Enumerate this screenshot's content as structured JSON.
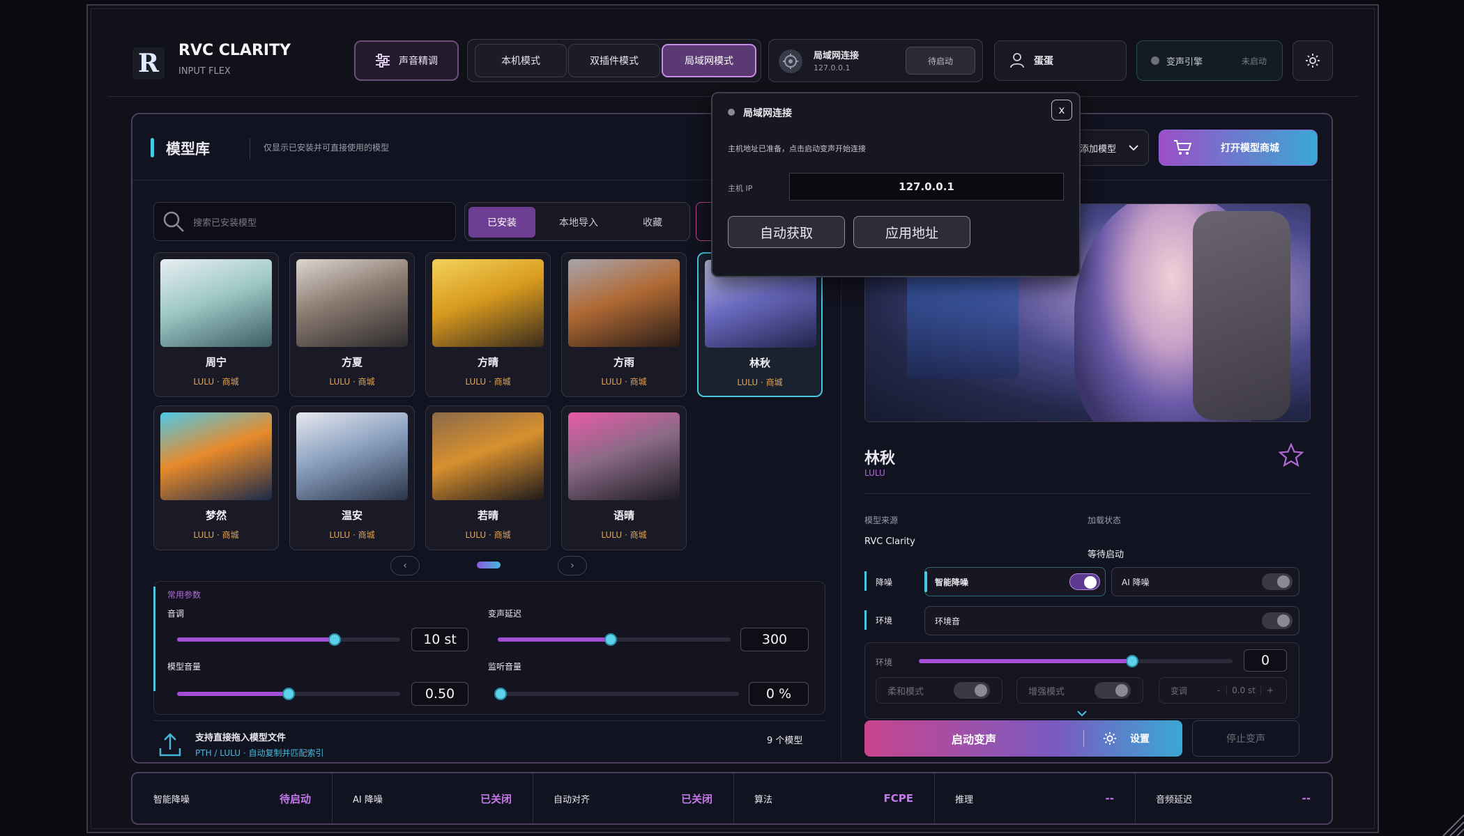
{
  "app": {
    "logo_letter": "R",
    "title": "RVC CLARITY",
    "subtitle": "INPUT FLEX"
  },
  "toolbar": {
    "tune_label": "声音精调",
    "modes": [
      {
        "label": "本机模式",
        "active": false
      },
      {
        "label": "双插件模式",
        "active": false
      },
      {
        "label": "局域网模式",
        "active": true
      }
    ],
    "lan": {
      "title": "局域网连接",
      "address": "127.0.0.1",
      "status": "待启动"
    },
    "user": {
      "name": "蛋蛋"
    },
    "engine": {
      "label": "变声引擎",
      "status": "未启动"
    }
  },
  "library": {
    "title": "模型库",
    "description": "仅显示已安装并可直接使用的模型",
    "add_model_label": "添加模型",
    "shop_label": "打开模型商城",
    "search_placeholder": "搜索已安装模型",
    "tabs": [
      {
        "label": "已安装",
        "active": true
      },
      {
        "label": "本地导入",
        "active": false
      },
      {
        "label": "收藏",
        "active": false
      }
    ],
    "models": [
      {
        "name": "周宁",
        "meta": "LULU · 商城",
        "selected": false
      },
      {
        "name": "方夏",
        "meta": "LULU · 商城",
        "selected": false
      },
      {
        "name": "方晴",
        "meta": "LULU · 商城",
        "selected": false
      },
      {
        "name": "方雨",
        "meta": "LULU · 商城",
        "selected": false
      },
      {
        "name": "林秋",
        "meta": "LULU · 商城",
        "selected": true
      },
      {
        "name": "梦然",
        "meta": "LULU · 商城",
        "selected": false
      },
      {
        "name": "温安",
        "meta": "LULU · 商城",
        "selected": false
      },
      {
        "name": "若晴",
        "meta": "LULU · 商城",
        "selected": false
      },
      {
        "name": "语晴",
        "meta": "LULU · 商城",
        "selected": false
      }
    ]
  },
  "params": {
    "title": "常用参数",
    "pitch": {
      "label": "音调",
      "value": "10 st",
      "level": 0.7
    },
    "delay": {
      "label": "变声延迟",
      "value": "300",
      "level": 0.48
    },
    "model_volume": {
      "label": "模型音量",
      "value": "0.50",
      "level": 0.5
    },
    "monitor_volume": {
      "label": "监听音量",
      "value": "0 %",
      "level": 0.0
    }
  },
  "upload": {
    "title": "支持直接拖入模型文件",
    "subtitle": "PTH / LULU · 自动复制并匹配索引",
    "count": "9 个模型"
  },
  "detail": {
    "name": "林秋",
    "author": "LULU",
    "source_label": "模型来源",
    "source_value": "RVC Clarity",
    "load_label": "加载状态",
    "load_value": "等待启动",
    "noise_label": "降噪",
    "smart_noise_label": "智能降噪",
    "smart_noise_on": true,
    "ai_noise_label": "AI 降噪",
    "ai_noise_on": false,
    "env_label": "环境",
    "env_sound_label": "环境音",
    "env_sound_on": false,
    "env_slider": {
      "label": "环境",
      "value": "0",
      "level": 0.68
    },
    "soft_mode_label": "柔和模式",
    "enhance_mode_label": "增强模式",
    "pitch_shift": {
      "label": "变调",
      "minus": "-",
      "value": "0.0 st",
      "plus": "+"
    },
    "start_label": "启动变声",
    "settings_label": "设置",
    "stop_label": "停止变声"
  },
  "statusbar": [
    {
      "label": "智能降噪",
      "value": "待启动"
    },
    {
      "label": "AI 降噪",
      "value": "已关闭"
    },
    {
      "label": "自动对齐",
      "value": "已关闭"
    },
    {
      "label": "算法",
      "value": "FCPE"
    },
    {
      "label": "推理",
      "value": "--"
    },
    {
      "label": "音频延迟",
      "value": "--"
    }
  ],
  "dialog": {
    "title": "局域网连接",
    "message": "主机地址已准备，点击启动变声开始连接",
    "ip_label": "主机 IP",
    "ip_value": "127.0.0.1",
    "auto_btn": "自动获取",
    "apply_btn": "应用地址",
    "close": "x"
  },
  "colors": {
    "accent_cyan": "#46c9e0",
    "accent_purple": "#a24fd6",
    "warm_meta": "#e0a456"
  }
}
